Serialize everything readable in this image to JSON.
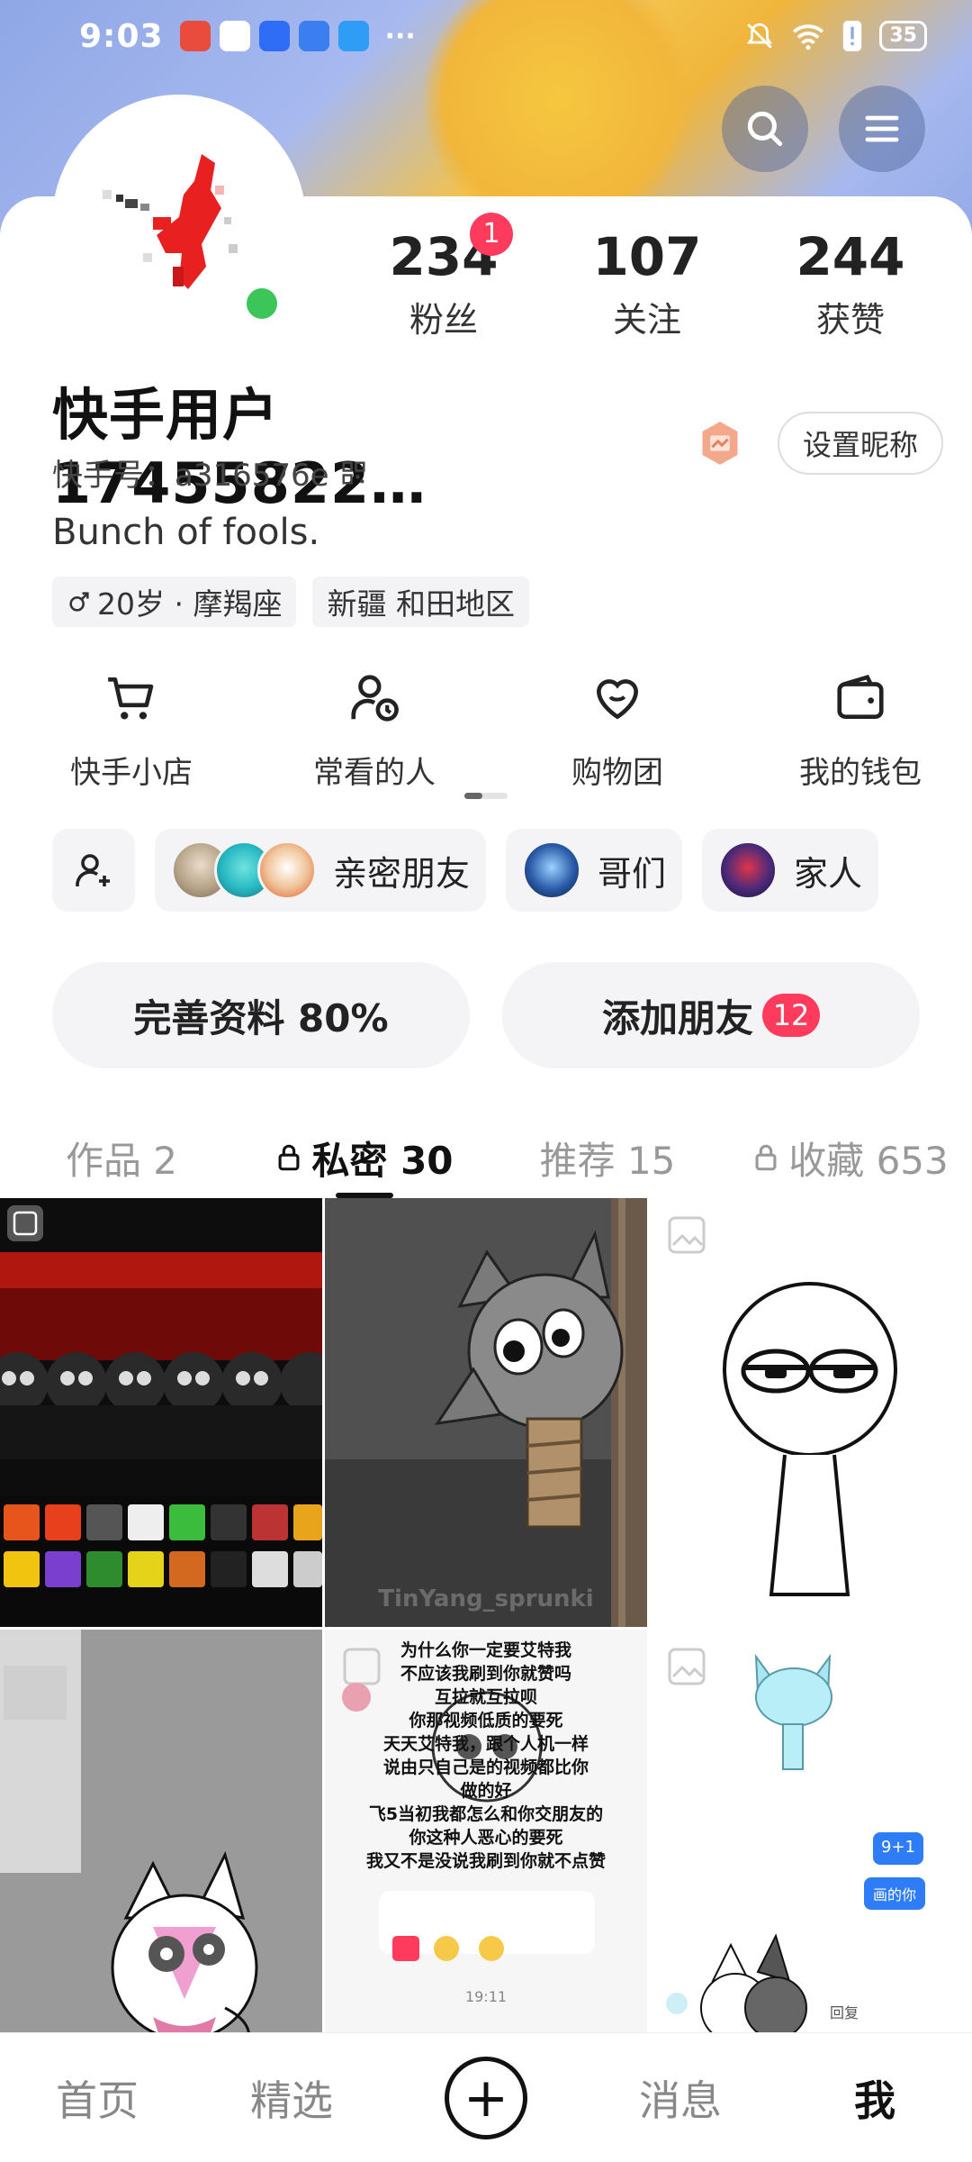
{
  "status_bar": {
    "time": "9:03",
    "battery": "35",
    "overflow": "···"
  },
  "header": {
    "search_icon": "search-icon",
    "menu_icon": "menu-icon"
  },
  "profile": {
    "name": "快手用户17455822…",
    "set_nickname": "设置昵称",
    "kuaishou_id": "快手号：a316576e",
    "bio": "Bunch of fools.",
    "tags": {
      "age": "20岁 · 摩羯座",
      "location": "新疆 和田地区"
    }
  },
  "stats": [
    {
      "value": "234",
      "label": "粉丝",
      "badge": "1"
    },
    {
      "value": "107",
      "label": "关注"
    },
    {
      "value": "244",
      "label": "获赞"
    }
  ],
  "services": [
    {
      "label": "快手小店",
      "icon": "cart-icon"
    },
    {
      "label": "常看的人",
      "icon": "person-clock-icon"
    },
    {
      "label": "购物团",
      "icon": "heart-group-icon"
    },
    {
      "label": "我的钱包",
      "icon": "wallet-icon"
    }
  ],
  "friend_groups": [
    {
      "label": "亲密朋友"
    },
    {
      "label": "哥们"
    },
    {
      "label": "家人"
    }
  ],
  "actions": {
    "complete_profile": "完善资料 80%",
    "add_friends": "添加朋友",
    "add_friends_badge": "12"
  },
  "tabs": [
    {
      "label": "作品 2",
      "locked": false,
      "active": false
    },
    {
      "label": "私密 30",
      "locked": true,
      "active": true
    },
    {
      "label": "推荐 15",
      "locked": false,
      "active": false
    },
    {
      "label": "收藏 653",
      "locked": true,
      "active": false
    }
  ],
  "grid": {
    "cell5_text": [
      "为什么你一定要艾特我",
      "不应该我刷到你就赞吗",
      "互拉就互拉呗",
      "你那视频低质的要死",
      "天天艾特我，跟个人机一样",
      "说由只自己是的视频都比你",
      "做的好",
      "飞5当初我都怎么和你交朋友的",
      "你这种人恶心的要死",
      "我又不是没说我刷到你就不点赞"
    ],
    "cell5_time": "19:11",
    "cell6_badge1": "9+1",
    "cell6_badge2": "画的你",
    "cell6_reply": "回复",
    "cell2_watermark": "TinYang_sprunki"
  },
  "bottom_nav": [
    {
      "label": "首页",
      "active": false
    },
    {
      "label": "精选",
      "active": false
    },
    {
      "label": "+",
      "active": false
    },
    {
      "label": "消息",
      "active": false
    },
    {
      "label": "我",
      "active": true
    }
  ]
}
